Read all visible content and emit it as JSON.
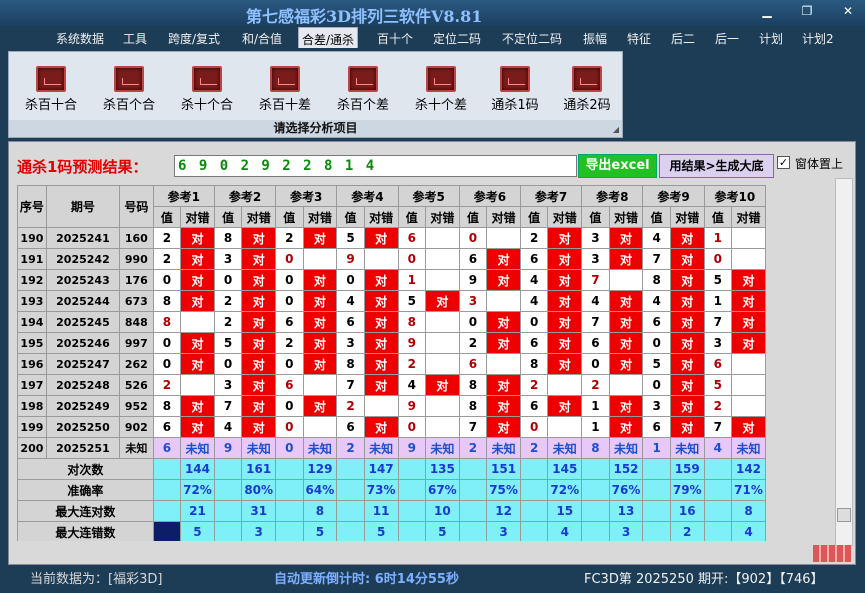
{
  "window": {
    "title": "第七感福彩3D排列三软件V8.81"
  },
  "menu": [
    "系统数据",
    "工具",
    "跨度/复式",
    "和/合值",
    "合差/通杀",
    "百十个",
    "定位二码",
    "不定位二码",
    "振幅",
    "特征",
    "后二",
    "后一",
    "计划",
    "计划2"
  ],
  "ribbon": {
    "buttons": [
      "杀百十合",
      "杀百个合",
      "杀十个合",
      "杀百十差",
      "杀百个差",
      "杀十个差",
      "通杀1码",
      "通杀2码"
    ],
    "caption": "请选择分析项目"
  },
  "prediction": {
    "label": "通杀1码预测结果：",
    "value": "6 9 0 2 9 2 2 8 1 4",
    "export_label": "导出excel",
    "gen_label": "用结果>生成大底",
    "ontop_label": "窗体置上"
  },
  "table": {
    "headers": [
      "序号",
      "期号",
      "号码"
    ],
    "ref_headers": [
      "参考1",
      "参考2",
      "参考3",
      "参考4",
      "参考5",
      "参考6",
      "参考7",
      "参考8",
      "参考9",
      "参考10"
    ],
    "sub_headers": [
      "值",
      "对错"
    ],
    "rows": [
      {
        "seq": "190",
        "issue": "2025241",
        "num": "160",
        "vals": [
          "2",
          "8",
          "2",
          "5",
          "6",
          "0",
          "2",
          "3",
          "4",
          "1"
        ],
        "marks": [
          "对",
          "对",
          "对",
          "对",
          "",
          "",
          "对",
          "对",
          "对",
          ""
        ]
      },
      {
        "seq": "191",
        "issue": "2025242",
        "num": "990",
        "vals": [
          "2",
          "3",
          "0",
          "9",
          "0",
          "6",
          "6",
          "3",
          "7",
          "0"
        ],
        "marks": [
          "对",
          "对",
          "",
          "",
          "",
          "对",
          "对",
          "对",
          "对",
          ""
        ]
      },
      {
        "seq": "192",
        "issue": "2025243",
        "num": "176",
        "vals": [
          "0",
          "0",
          "0",
          "0",
          "1",
          "9",
          "4",
          "7",
          "8",
          "5"
        ],
        "marks": [
          "对",
          "对",
          "对",
          "对",
          "",
          "对",
          "对",
          "",
          "对",
          "对"
        ]
      },
      {
        "seq": "193",
        "issue": "2025244",
        "num": "673",
        "vals": [
          "8",
          "2",
          "0",
          "4",
          "5",
          "3",
          "4",
          "4",
          "4",
          "1"
        ],
        "marks": [
          "对",
          "对",
          "对",
          "对",
          "对",
          "",
          "对",
          "对",
          "对",
          "对"
        ]
      },
      {
        "seq": "194",
        "issue": "2025245",
        "num": "848",
        "vals": [
          "8",
          "2",
          "6",
          "6",
          "8",
          "0",
          "0",
          "7",
          "6",
          "7"
        ],
        "marks": [
          "",
          "对",
          "对",
          "对",
          "",
          "对",
          "对",
          "对",
          "对",
          "对"
        ]
      },
      {
        "seq": "195",
        "issue": "2025246",
        "num": "997",
        "vals": [
          "0",
          "5",
          "2",
          "3",
          "9",
          "2",
          "6",
          "6",
          "0",
          "3"
        ],
        "marks": [
          "对",
          "对",
          "对",
          "对",
          "",
          "对",
          "对",
          "对",
          "对",
          "对"
        ]
      },
      {
        "seq": "196",
        "issue": "2025247",
        "num": "262",
        "vals": [
          "0",
          "0",
          "0",
          "8",
          "2",
          "6",
          "8",
          "0",
          "5",
          "6"
        ],
        "marks": [
          "对",
          "对",
          "对",
          "对",
          "",
          "",
          "对",
          "对",
          "对",
          ""
        ]
      },
      {
        "seq": "197",
        "issue": "2025248",
        "num": "526",
        "vals": [
          "2",
          "3",
          "6",
          "7",
          "4",
          "8",
          "2",
          "2",
          "0",
          "5"
        ],
        "marks": [
          "",
          "对",
          "",
          "对",
          "对",
          "对",
          "",
          "",
          "对",
          ""
        ]
      },
      {
        "seq": "198",
        "issue": "2025249",
        "num": "952",
        "vals": [
          "8",
          "7",
          "0",
          "2",
          "9",
          "8",
          "6",
          "1",
          "3",
          "2"
        ],
        "marks": [
          "对",
          "对",
          "对",
          "",
          "",
          "对",
          "对",
          "对",
          "对",
          ""
        ]
      },
      {
        "seq": "199",
        "issue": "2025250",
        "num": "902",
        "vals": [
          "6",
          "4",
          "0",
          "6",
          "0",
          "7",
          "0",
          "1",
          "6",
          "7"
        ],
        "marks": [
          "对",
          "对",
          "",
          "对",
          "",
          "对",
          "",
          "对",
          "对",
          "对"
        ]
      },
      {
        "seq": "200",
        "issue": "2025251",
        "num": "未知",
        "vals": [
          "6",
          "9",
          "0",
          "2",
          "9",
          "2",
          "2",
          "8",
          "1",
          "4"
        ],
        "marks": [
          "未知",
          "未知",
          "未知",
          "未知",
          "未知",
          "未知",
          "未知",
          "未知",
          "未知",
          "未知"
        ]
      }
    ],
    "stats": [
      {
        "label": "对次数",
        "values": [
          "144",
          "161",
          "129",
          "147",
          "135",
          "151",
          "145",
          "152",
          "159",
          "142"
        ]
      },
      {
        "label": "准确率",
        "values": [
          "72%",
          "80%",
          "64%",
          "73%",
          "67%",
          "75%",
          "72%",
          "76%",
          "79%",
          "71%"
        ]
      },
      {
        "label": "最大连对数",
        "values": [
          "21",
          "31",
          "8",
          "11",
          "10",
          "12",
          "15",
          "13",
          "16",
          "8"
        ]
      },
      {
        "label": "最大连错数",
        "values": [
          "5",
          "3",
          "5",
          "5",
          "5",
          "3",
          "4",
          "3",
          "2",
          "4"
        ]
      }
    ]
  },
  "status": {
    "current": "当前数据为：[福彩3D]",
    "countdown": "自动更新倒计时:  6时14分55秒",
    "draw": "FC3D第 2025250 期开:【902】【746】"
  }
}
